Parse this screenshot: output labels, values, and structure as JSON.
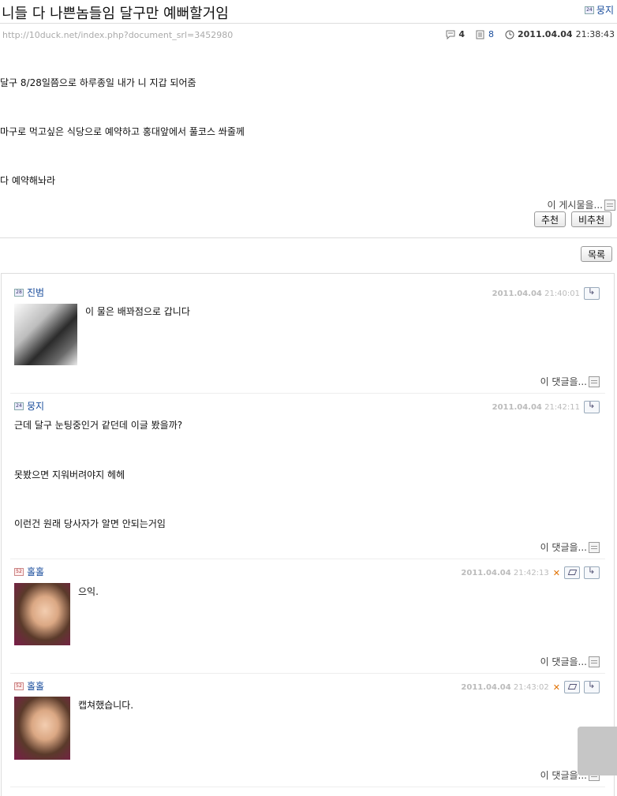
{
  "post": {
    "title": "니들 다 나쁜놈들임 달구만 예뻐할거임",
    "author": "뭉지",
    "author_level": "24",
    "url": "http://10duck.net/index.php?document_srl=3452980",
    "comment_count": "4",
    "read_count": "8",
    "date": "2011.04.04",
    "time": "21:38:43",
    "lines": [
      "달구 8/28일쯤으로 하루종일 내가 니 지갑 되어줌",
      "마구로 먹고싶은 식당으로 예약하고 홍대앞에서 풀코스 쏴줄께",
      "다 예약해놔라"
    ],
    "more_label": "이 게시물을...",
    "recommend_label": "추천",
    "unrecommend_label": "비추천",
    "list_label": "목록"
  },
  "comments": [
    {
      "level": "28",
      "name": "진범",
      "date": "2011.04.04",
      "time": "21:40:01",
      "lines": [
        "이 물은 배꽈점으로 갑니다"
      ],
      "more_label": "이 댓글을..."
    },
    {
      "level": "24",
      "name": "뭉지",
      "date": "2011.04.04",
      "time": "21:42:11",
      "lines": [
        "근데 달구 눈팅중인거 같던데 이글 봤을까?",
        "못봤으면 지워버려야지 헤헤",
        "이런건 원래 당사자가 알면 안되는거임"
      ],
      "more_label": "이 댓글을..."
    },
    {
      "level": "52",
      "name": "홀홀",
      "date": "2011.04.04",
      "time": "21:42:13",
      "lines": [
        "으익."
      ],
      "more_label": "이 댓글을..."
    },
    {
      "level": "52",
      "name": "홀홀",
      "date": "2011.04.04",
      "time": "21:43:02",
      "lines": [
        "캡쳐했습니다."
      ],
      "more_label": "이 댓글을..."
    }
  ],
  "colors": {
    "link": "#1a4d9c",
    "delete": "#e07000",
    "date": "#bbbbbb"
  }
}
